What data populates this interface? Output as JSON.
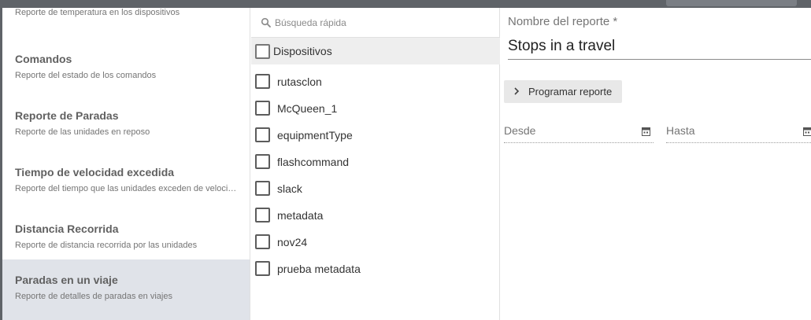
{
  "reports": [
    {
      "title": "",
      "description": "Reporte de temperatura en los dispositivos",
      "selected": false
    },
    {
      "title": "Comandos",
      "description": "Reporte del estado de los comandos",
      "selected": false
    },
    {
      "title": "Reporte de Paradas",
      "description": "Reporte de las unidades en reposo",
      "selected": false
    },
    {
      "title": "Tiempo de velocidad excedida",
      "description": "Reporte del tiempo que las unidades exceden de velocidad",
      "selected": false
    },
    {
      "title": "Distancia Recorrida",
      "description": "Reporte de distancia recorrida por las unidades",
      "selected": false
    },
    {
      "title": "Paradas en un viaje",
      "description": "Reporte de detalles de paradas en viajes",
      "selected": true
    }
  ],
  "devices": {
    "search": {
      "placeholder": "Búsqueda rápida",
      "value": ""
    },
    "group_label": "Dispositivos",
    "items": [
      "rutasclon",
      "McQueen_1",
      "equipmentType",
      "flashcommand",
      "slack",
      "metadata",
      "nov24",
      "prueba metadata"
    ]
  },
  "form": {
    "name_label": "Nombre del reporte *",
    "name_value": "Stops in a travel",
    "schedule_label": "Programar reporte",
    "from_label": "Desde",
    "to_label": "Hasta"
  },
  "icons": {
    "search": "search-icon",
    "calendar": "calendar-icon",
    "chevron": "chevron-right-icon"
  }
}
